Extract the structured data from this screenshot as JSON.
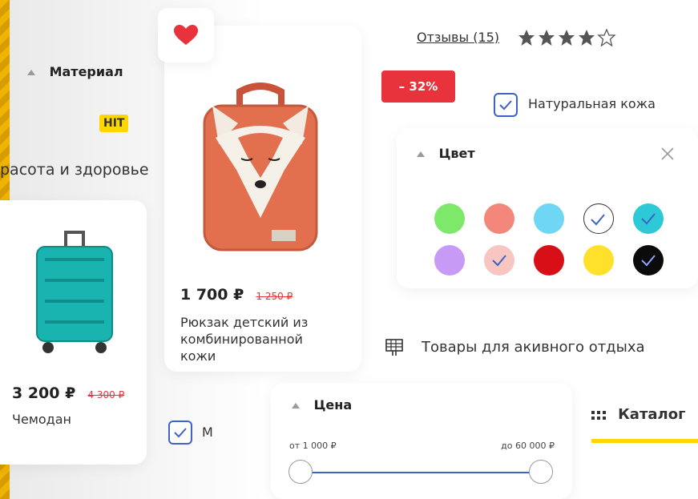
{
  "filters": {
    "material": {
      "title": "Материал",
      "option_label": "Натуральная кожа",
      "checked": true
    },
    "color": {
      "title": "Цвет",
      "swatches": [
        {
          "color": "#7de86a",
          "selected": false
        },
        {
          "color": "#f4877b",
          "selected": false
        },
        {
          "color": "#6fd6f4",
          "selected": false
        },
        {
          "color": "#ffffff",
          "selected": true
        },
        {
          "color": "#2dc9d6",
          "selected": true
        },
        {
          "color": "#c79bf5",
          "selected": false
        },
        {
          "color": "#f7c6c0",
          "selected": true
        },
        {
          "color": "#d80f16",
          "selected": false
        },
        {
          "color": "#ffe02b",
          "selected": false
        },
        {
          "color": "#0b0b0b",
          "selected": true
        }
      ]
    },
    "price": {
      "title": "Цена",
      "from_label": "от 1 000 ₽",
      "to_label": "до 60 000 ₽"
    },
    "partial_checkbox_label": "М"
  },
  "badges": {
    "hit": "HIT",
    "discount": "– 32%"
  },
  "categories": {
    "beauty": "расота и здоровье",
    "active": "Товары для акивного отдыха"
  },
  "catalog_label": "Каталог",
  "reviews": {
    "label": "Отзывы (15)",
    "rating": 4,
    "max": 5
  },
  "products": {
    "backpack": {
      "price": "1 700 ₽",
      "old_price": "1 250 ₽",
      "name_line1": "Рюкзак детский из",
      "name_line2": "комбинированной",
      "name_line3": "кожи"
    },
    "suitcase": {
      "price": "3 200 ₽",
      "old_price": "4 300 ₽",
      "name": "Чемодан"
    }
  },
  "colors": {
    "accent": "#3e63c7",
    "discount_bg": "#e8323c",
    "hit_bg": "#ffd600",
    "catalog_underline": "#ffd600",
    "heart": "#e8323c"
  },
  "icons": [
    "heart-icon",
    "triangle-collapse-icon",
    "close-icon",
    "check-icon",
    "grid-icon",
    "catalog-dots-icon",
    "star-icon"
  ]
}
